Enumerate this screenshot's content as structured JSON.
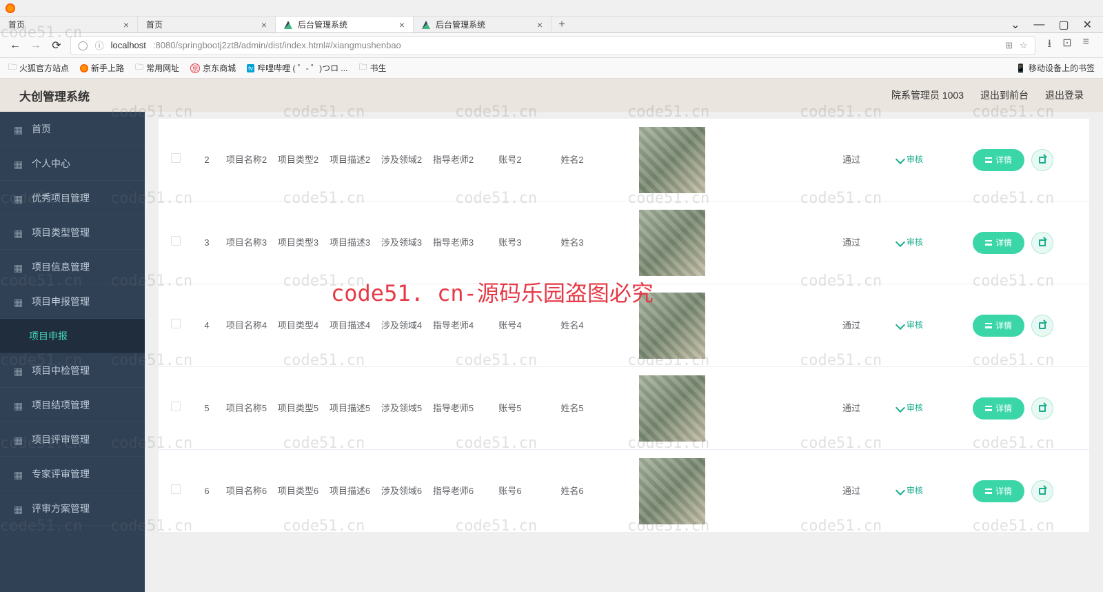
{
  "browser": {
    "tabs": [
      {
        "title": "首页",
        "active": false,
        "hasIcon": false
      },
      {
        "title": "首页",
        "active": false,
        "hasIcon": false
      },
      {
        "title": "后台管理系统",
        "active": true,
        "hasIcon": true
      },
      {
        "title": "后台管理系统",
        "active": false,
        "hasIcon": true
      }
    ],
    "url_host": "localhost",
    "url_path": ":8080/springbootj2zt8/admin/dist/index.html#/xiangmushenbao",
    "bookmarks": [
      "火狐官方站点",
      "新手上路",
      "常用网址",
      "京东商城",
      "哔哩哔哩 (  ゜- ゜)つロ ...",
      "书生"
    ],
    "bookmark_right": "移动设备上的书签"
  },
  "app": {
    "title": "大创管理系统",
    "header_user": "院系管理员 1003",
    "header_logout_front": "退出到前台",
    "header_logout": "退出登录"
  },
  "sidebar": [
    {
      "label": "首页",
      "icon": "home-icon"
    },
    {
      "label": "个人中心",
      "icon": "user-icon"
    },
    {
      "label": "优秀项目管理",
      "icon": "list-icon"
    },
    {
      "label": "项目类型管理",
      "icon": "list-icon"
    },
    {
      "label": "项目信息管理",
      "icon": "list-icon"
    },
    {
      "label": "项目申报管理",
      "icon": "chart-icon"
    },
    {
      "label": "项目申报",
      "icon": "",
      "sub": true,
      "active": true
    },
    {
      "label": "项目中检管理",
      "icon": "check-icon"
    },
    {
      "label": "项目结项管理",
      "icon": "flag-icon"
    },
    {
      "label": "项目评审管理",
      "icon": "review-icon"
    },
    {
      "label": "专家评审管理",
      "icon": "expert-icon"
    },
    {
      "label": "评审方案管理",
      "icon": "plan-icon"
    }
  ],
  "table": {
    "status_pass": "通过",
    "audit_label": "审核",
    "detail_label": "详情",
    "rows": [
      {
        "idx": "2",
        "name": "项目名称2",
        "type": "项目类型2",
        "desc": "项目描述2",
        "field": "涉及领域2",
        "teacher": "指导老师2",
        "account": "账号2",
        "fullname": "姓名2"
      },
      {
        "idx": "3",
        "name": "项目名称3",
        "type": "项目类型3",
        "desc": "项目描述3",
        "field": "涉及领域3",
        "teacher": "指导老师3",
        "account": "账号3",
        "fullname": "姓名3"
      },
      {
        "idx": "4",
        "name": "项目名称4",
        "type": "项目类型4",
        "desc": "项目描述4",
        "field": "涉及领域4",
        "teacher": "指导老师4",
        "account": "账号4",
        "fullname": "姓名4"
      },
      {
        "idx": "5",
        "name": "项目名称5",
        "type": "项目类型5",
        "desc": "项目描述5",
        "field": "涉及领域5",
        "teacher": "指导老师5",
        "account": "账号5",
        "fullname": "姓名5"
      },
      {
        "idx": "6",
        "name": "项目名称6",
        "type": "项目类型6",
        "desc": "项目描述6",
        "field": "涉及领域6",
        "teacher": "指导老师6",
        "account": "账号6",
        "fullname": "姓名6"
      }
    ]
  },
  "watermark": {
    "text": "code51.cn",
    "big": "code51. cn-源码乐园盗图必究"
  }
}
